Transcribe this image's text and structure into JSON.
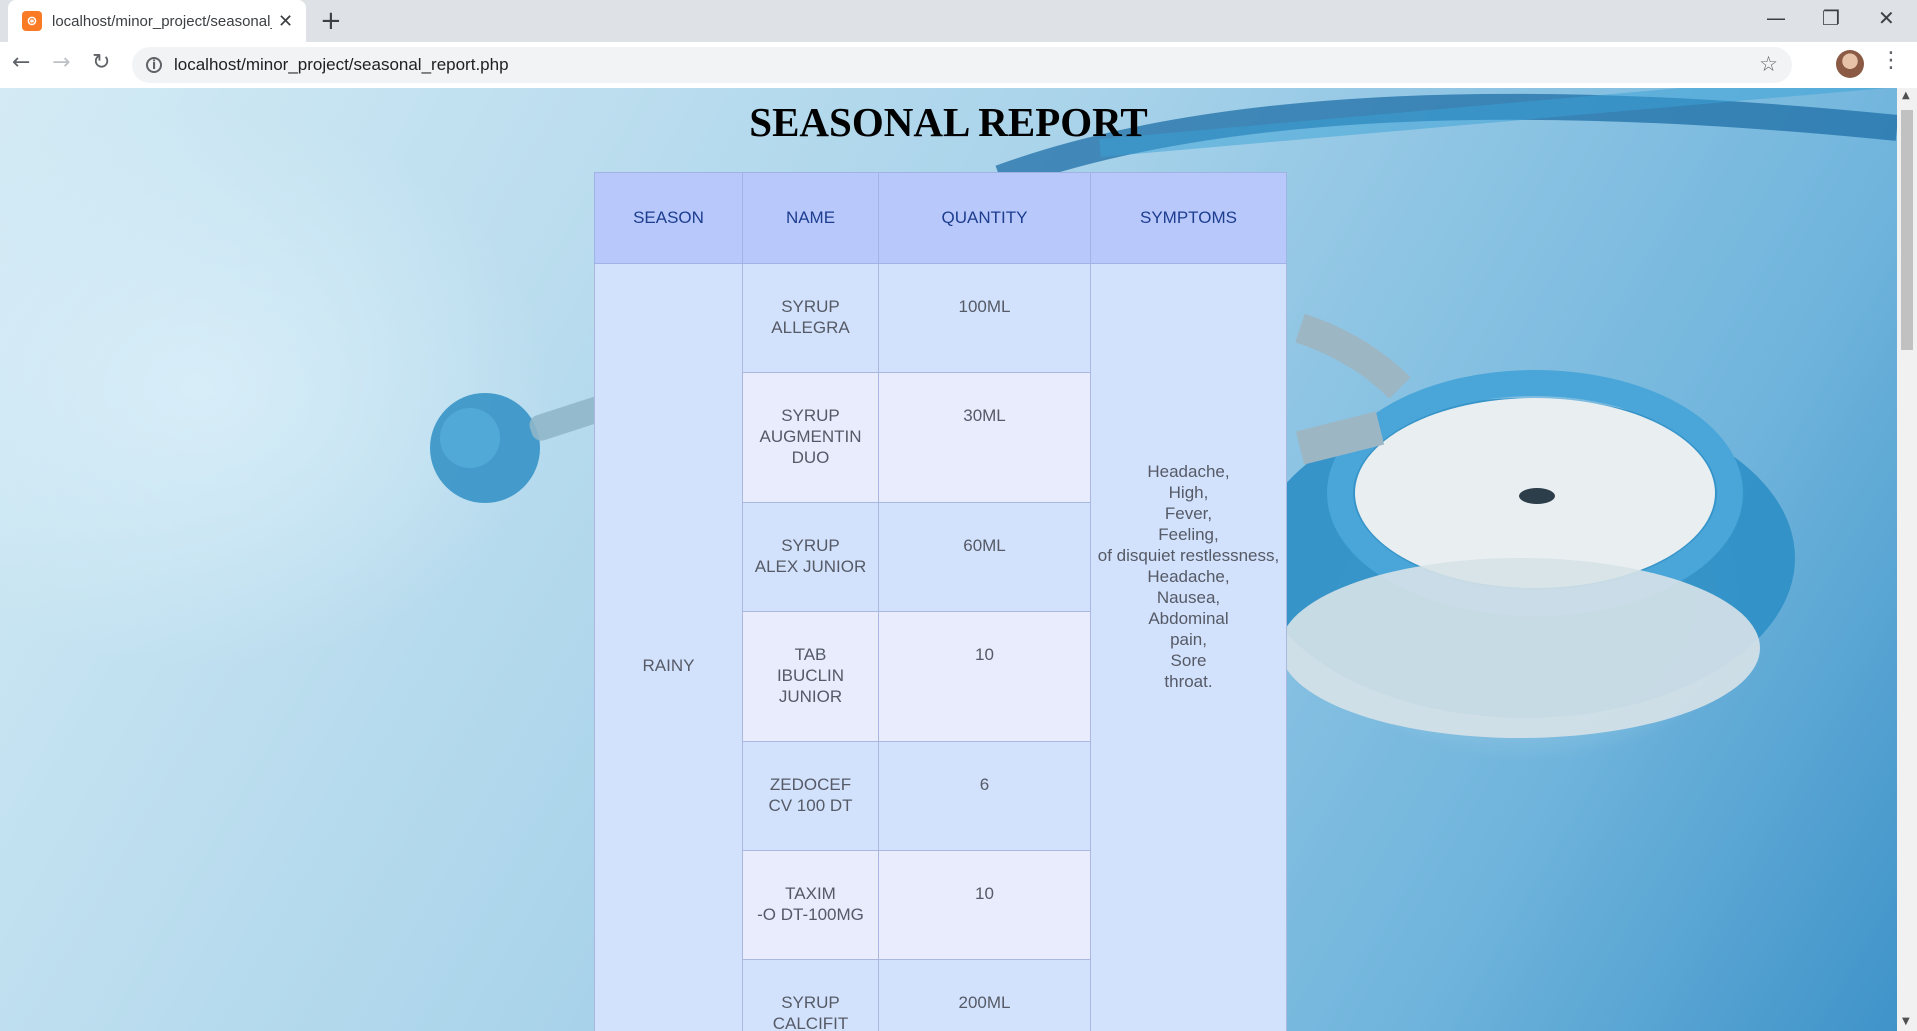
{
  "browser": {
    "tab_title": "localhost/minor_project/seasonal_report.php",
    "favicon": "xampp-icon",
    "url": "localhost/minor_project/seasonal_report.php"
  },
  "page": {
    "title": "SEASONAL REPORT",
    "headers": [
      "SEASON",
      "NAME",
      "QUANTITY",
      "SYMPTOMS"
    ],
    "season": "RAINY",
    "symptoms": [
      "Headache,",
      "High,",
      "Fever,",
      "Feeling,",
      "of disquiet restlessness,",
      "Headache,",
      "Nausea,",
      "Abdominal",
      "pain,",
      "Sore",
      "throat."
    ],
    "rows": [
      {
        "name": [
          "SYRUP",
          "ALLEGRA"
        ],
        "quantity": "100ML"
      },
      {
        "name": [
          "SYRUP",
          "AUGMENTIN",
          "DUO"
        ],
        "quantity": "30ML"
      },
      {
        "name": [
          "SYRUP",
          "ALEX JUNIOR"
        ],
        "quantity": "60ML"
      },
      {
        "name": [
          "TAB",
          "IBUCLIN",
          "JUNIOR"
        ],
        "quantity": "10"
      },
      {
        "name": [
          "ZEDOCEF",
          "CV 100 DT"
        ],
        "quantity": "6"
      },
      {
        "name": [
          "TAXIM",
          "-O DT-100MG"
        ],
        "quantity": "10"
      },
      {
        "name": [
          "SYRUP",
          "CALCIFIT"
        ],
        "quantity": "200ML"
      }
    ]
  },
  "colors": {
    "header_bg": "#b8c8fa",
    "header_text": "#1d3d8f",
    "cell_bg": "#d3e2fc",
    "cell_alt_bg": "#e8ecfd"
  }
}
